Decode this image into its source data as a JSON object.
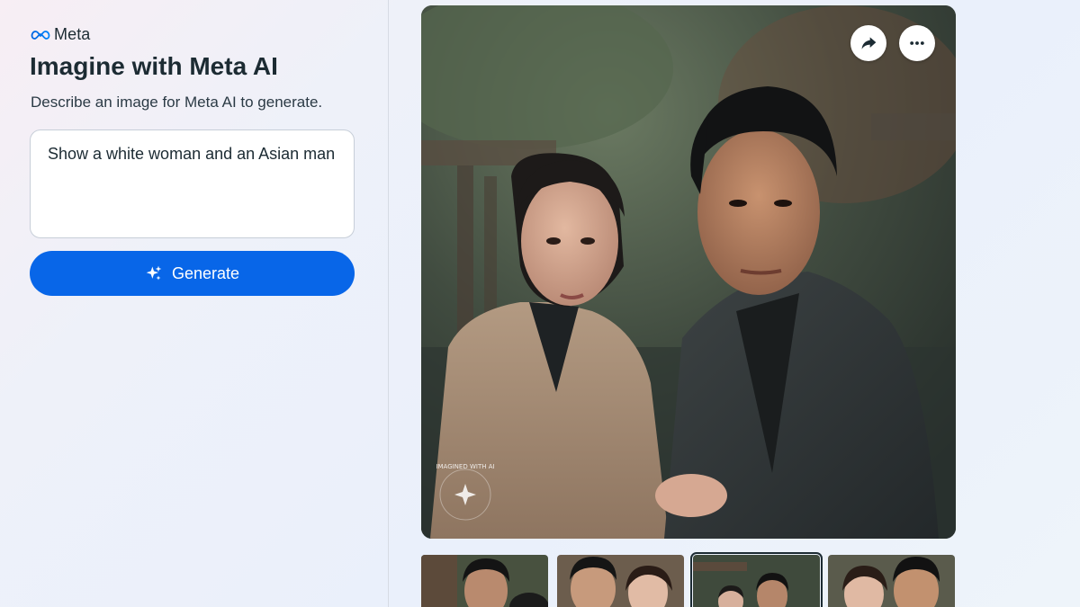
{
  "brand": {
    "logo_text": "Meta"
  },
  "header": {
    "title": "Imagine with Meta AI",
    "subtitle": "Describe an image for Meta AI to generate."
  },
  "prompt": {
    "value": "Show a white woman and an Asian man"
  },
  "generate_button": {
    "label": "Generate"
  },
  "image_actions": {
    "share_icon": "share-arrow-icon",
    "more_icon": "more-options-icon"
  },
  "watermark": {
    "text": "IMAGINED WITH AI"
  },
  "thumbnails": {
    "count_visible": 4,
    "selected_index": 2
  },
  "colors": {
    "accent": "#0866e8",
    "text": "#1c2b33"
  }
}
